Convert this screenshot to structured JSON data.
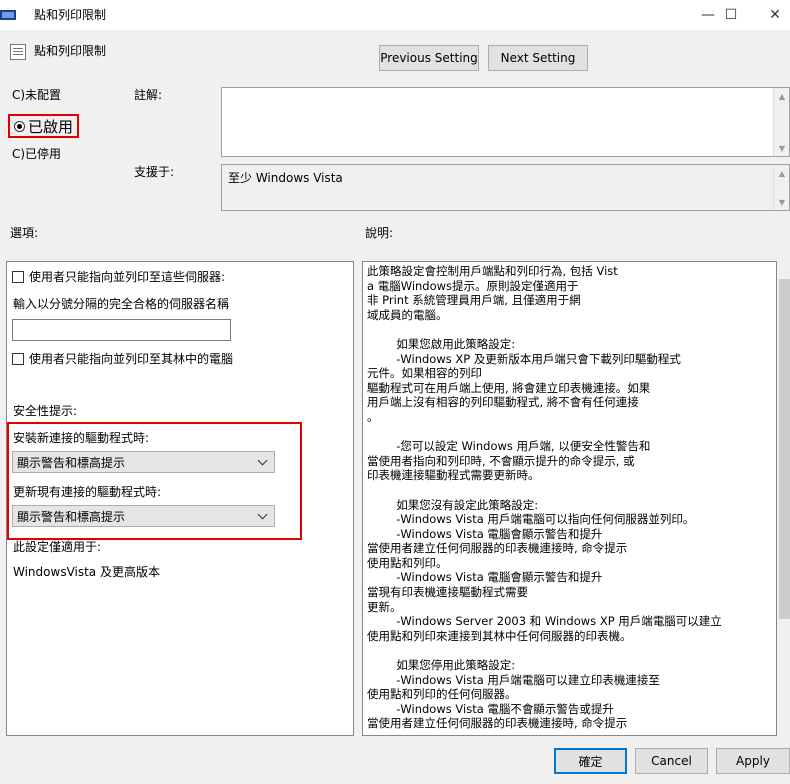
{
  "window": {
    "title": "點和列印限制",
    "minimize_glyph": "—",
    "maximize_glyph": "☐",
    "close_glyph": "✕"
  },
  "header": {
    "policy_name": "點和列印限制",
    "previous_label": "Previous Setting",
    "next_label": "Next Setting"
  },
  "state": {
    "not_configured": "C)未配置",
    "enabled": "已啟用",
    "disabled": "C)已停用"
  },
  "comment": {
    "label": "註解:"
  },
  "supported": {
    "label": "支援于:",
    "value": "至少 Windows Vista"
  },
  "options": {
    "label": "選項:",
    "chk_servers": "使用者只能指向並列印至這些伺服器:",
    "server_names_label": "輸入以分號分隔的完全合格的伺服器名稱",
    "chk_forest": "使用者只能指向並列印至其林中的電腦",
    "security_label": "安全性提示:",
    "install_label": "安裝新連接的驅動程式時:",
    "install_value": "顯示警告和標高提示",
    "update_label": "更新現有連接的驅動程式時:",
    "update_value": "顯示警告和標高提示",
    "applies_label": "此設定僅適用于:",
    "applies_value": "WindowsVista 及更高版本"
  },
  "help": {
    "label": "說明:",
    "text": "此策略設定會控制用戶端點和列印行為, 包括 Vist\na 電腦Windows提示。原則設定僅適用于\n非 Print 系統管理員用戶端, 且僅適用于網\n域成員的電腦。\n\n        如果您啟用此策略設定:\n        -Windows XP 及更新版本用戶端只會下載列印驅動程式\n元件。如果相容的列印\n驅動程式可在用戶端上使用, 將會建立印表機連接。如果\n用戶端上沒有相容的列印驅動程式, 將不會有任何連接\n。\n\n        -您可以設定 Windows 用戶端, 以便安全性警告和\n當使用者指向和列印時, 不會顯示提升的命令提示, 或\n印表機連接驅動程式需要更新時。\n\n        如果您沒有設定此策略設定:\n        -Windows Vista 用戶端電腦可以指向任何伺服器並列印。\n        -Windows Vista 電腦會顯示警告和提升\n當使用者建立任何伺服器的印表機連接時, 命令提示\n使用點和列印。\n        -Windows Vista 電腦會顯示警告和提升\n當現有印表機連接驅動程式需要\n更新。\n        -Windows Server 2003 和 Windows XP 用戶端電腦可以建立\n使用點和列印來連接到其林中任何伺服器的印表機。\n\n        如果您停用此策略設定:\n        -Windows Vista 用戶端電腦可以建立印表機連接至\n使用點和列印的任何伺服器。\n        -Windows Vista 電腦不會顯示警告或提升\n當使用者建立任何伺服器的印表機連接時, 命令提示"
  },
  "footer": {
    "ok_label": "確定",
    "cancel_label": "Cancel",
    "apply_label": "Apply"
  }
}
